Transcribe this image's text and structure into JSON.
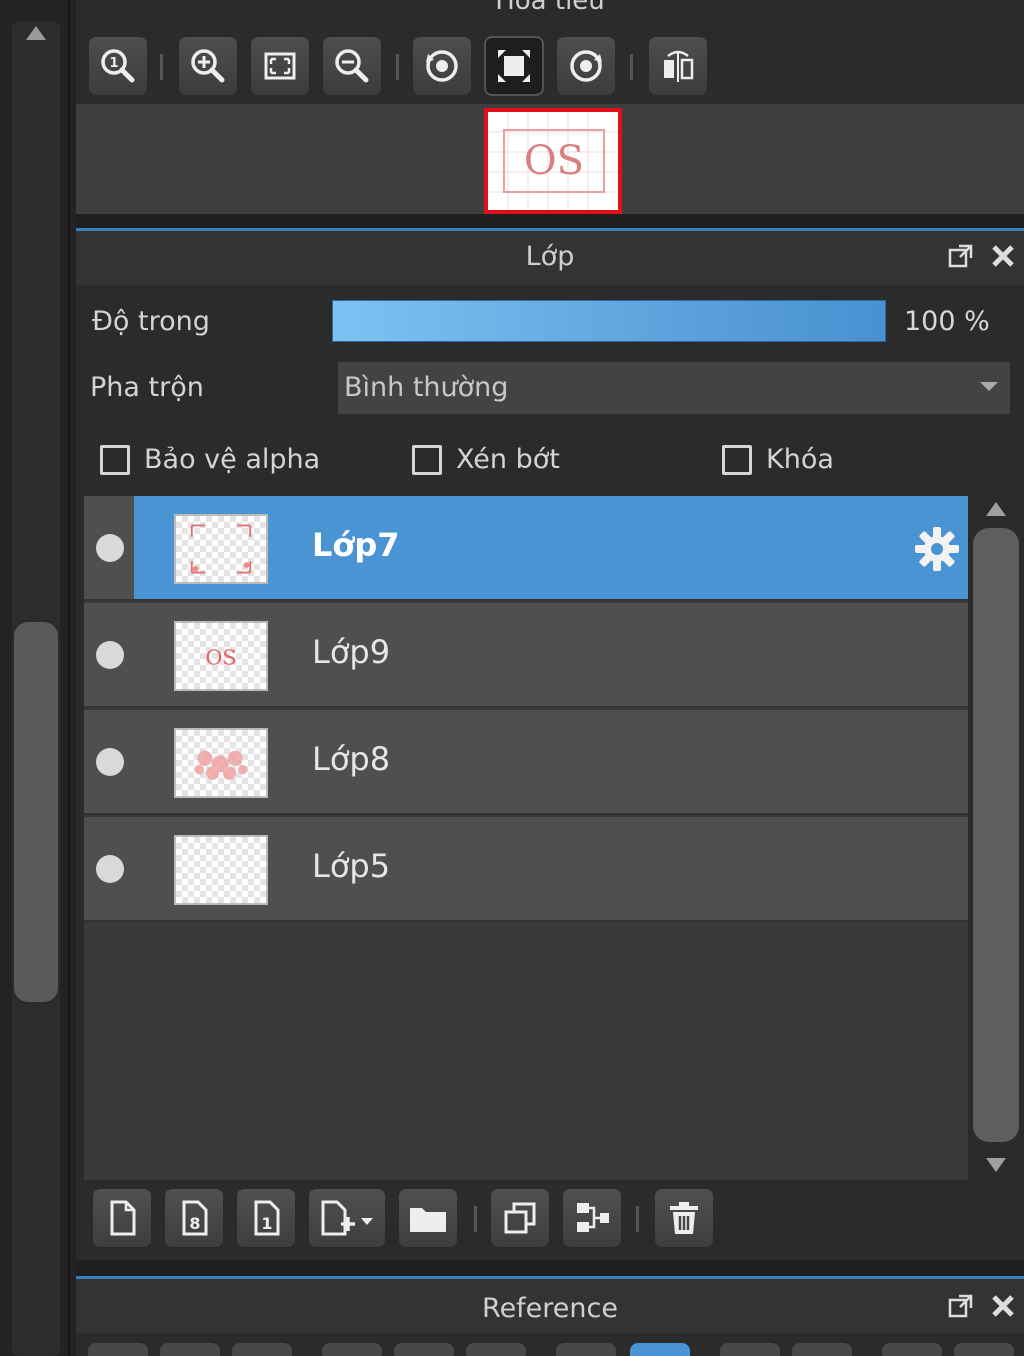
{
  "navigator": {
    "title": "Hoa tiêu",
    "thumbnail_text": "OS",
    "toolbar": [
      {
        "name": "zoom-actual-button",
        "icon": "magnifier-1-icon"
      },
      {
        "name": "zoom-in-button",
        "icon": "zoom-in-icon"
      },
      {
        "name": "fit-window-button",
        "icon": "fit-window-icon"
      },
      {
        "name": "zoom-out-button",
        "icon": "zoom-out-icon"
      },
      {
        "name": "rotate-left-button",
        "icon": "rotate-left-icon"
      },
      {
        "name": "fit-frame-button",
        "icon": "fit-frame-icon"
      },
      {
        "name": "rotate-right-button",
        "icon": "rotate-right-icon"
      },
      {
        "name": "flip-horizontal-button",
        "icon": "flip-horizontal-icon"
      }
    ]
  },
  "layer_panel": {
    "title": "Lớp",
    "opacity_label": "Độ trong",
    "opacity_value": "100 %",
    "opacity_fraction": 1.0,
    "blend_label": "Pha trộn",
    "blend_value": "Bình thường",
    "checkboxes": [
      {
        "label": "Bảo vệ alpha",
        "checked": false
      },
      {
        "label": "Xén bớt",
        "checked": false
      },
      {
        "label": "Khóa",
        "checked": false
      }
    ],
    "layers": [
      {
        "name": "Lớp7",
        "selected": true,
        "visible": true
      },
      {
        "name": "Lớp9",
        "selected": false,
        "visible": true
      },
      {
        "name": "Lớp8",
        "selected": false,
        "visible": true
      },
      {
        "name": "Lớp5",
        "selected": false,
        "visible": true
      }
    ],
    "thumb_text": "OS",
    "bottom_toolbar": [
      {
        "name": "new-layer-button",
        "icon": "new-page-icon"
      },
      {
        "name": "new-8bit-layer-button",
        "icon": "page-8-icon"
      },
      {
        "name": "new-1bit-layer-button",
        "icon": "page-1-icon"
      },
      {
        "name": "add-layer-menu-button",
        "icon": "page-add-dropdown-icon"
      },
      {
        "name": "new-folder-button",
        "icon": "folder-icon"
      },
      {
        "name": "duplicate-layer-button",
        "icon": "duplicate-icon"
      },
      {
        "name": "merge-down-button",
        "icon": "merge-down-icon"
      },
      {
        "name": "delete-layer-button",
        "icon": "trash-icon"
      }
    ]
  },
  "reference_panel": {
    "title": "Reference"
  },
  "colors": {
    "accent": "#4a94d4",
    "panel_bg": "#2b2b2b",
    "row_bg": "#4f4f4f",
    "thumb_border_red": "#e0101a"
  }
}
